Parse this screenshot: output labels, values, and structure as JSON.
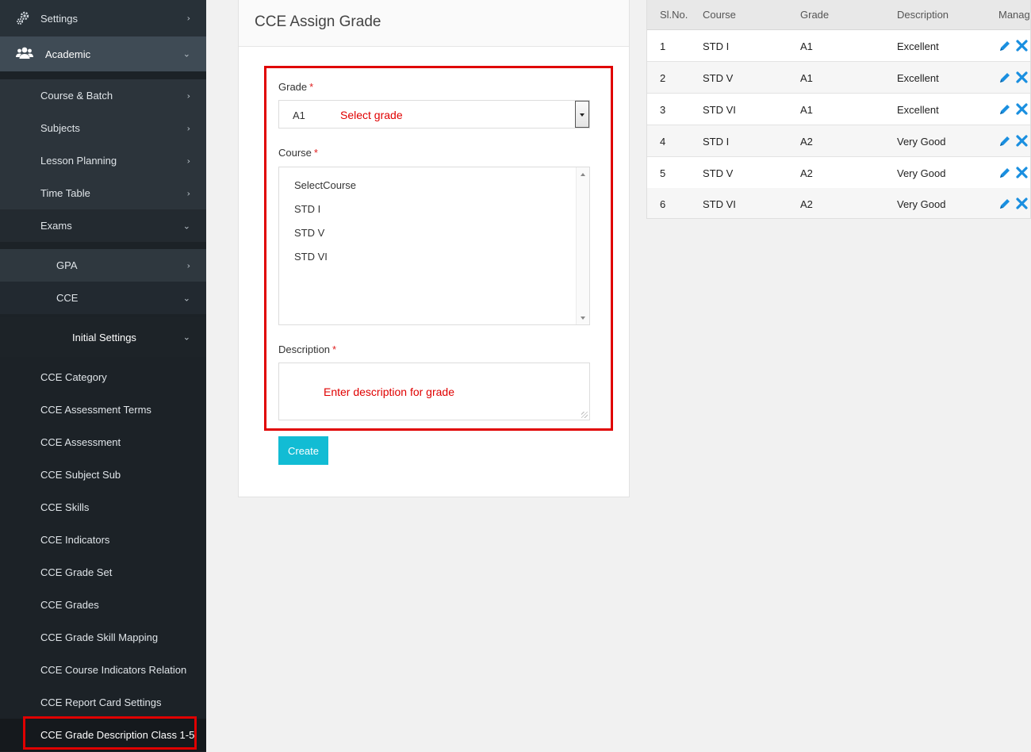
{
  "sidebar": {
    "settings_label": "Settings",
    "academic_label": "Academic",
    "items_l2": [
      "Course & Batch",
      "Subjects",
      "Lesson Planning",
      "Time Table",
      "Exams"
    ],
    "items_l3": [
      "GPA",
      "CCE"
    ],
    "initial_settings_label": "Initial Settings",
    "items_l5": [
      "CCE Category",
      "CCE Assessment Terms",
      "CCE Assessment",
      "CCE Subject Sub",
      "CCE Skills",
      "CCE Indicators",
      "CCE Grade Set",
      "CCE Grades",
      "CCE Grade Skill Mapping",
      "CCE Course Indicators Relation",
      "CCE Report Card Settings",
      "CCE Grade Description Class 1-5"
    ]
  },
  "form": {
    "title": "CCE Assign Grade",
    "grade_label": "Grade",
    "required_mark": "*",
    "grade_value": "A1",
    "grade_hint": "Select grade",
    "course_label": "Course",
    "course_options": [
      "SelectCourse",
      "STD I",
      "STD V",
      "STD VI"
    ],
    "description_label": "Description",
    "description_hint": "Enter description for grade",
    "create_label": "Create"
  },
  "table": {
    "headers": [
      "Sl.No.",
      "Course",
      "Grade",
      "Description",
      "Manage"
    ],
    "rows": [
      {
        "no": "1",
        "course": "STD I",
        "grade": "A1",
        "description": "Excellent"
      },
      {
        "no": "2",
        "course": "STD V",
        "grade": "A1",
        "description": "Excellent"
      },
      {
        "no": "3",
        "course": "STD VI",
        "grade": "A1",
        "description": "Excellent"
      },
      {
        "no": "4",
        "course": "STD I",
        "grade": "A2",
        "description": "Very Good"
      },
      {
        "no": "5",
        "course": "STD V",
        "grade": "A2",
        "description": "Very Good"
      },
      {
        "no": "6",
        "course": "STD VI",
        "grade": "A2",
        "description": "Very Good"
      }
    ]
  },
  "icons": {
    "settings": "gears-icon",
    "academic": "users-icon",
    "edit": "pencil-icon",
    "delete": "close-icon"
  },
  "colors": {
    "accent": "#12bcd4",
    "highlight": "#e00000",
    "action_blue": "#1a8fe0"
  }
}
